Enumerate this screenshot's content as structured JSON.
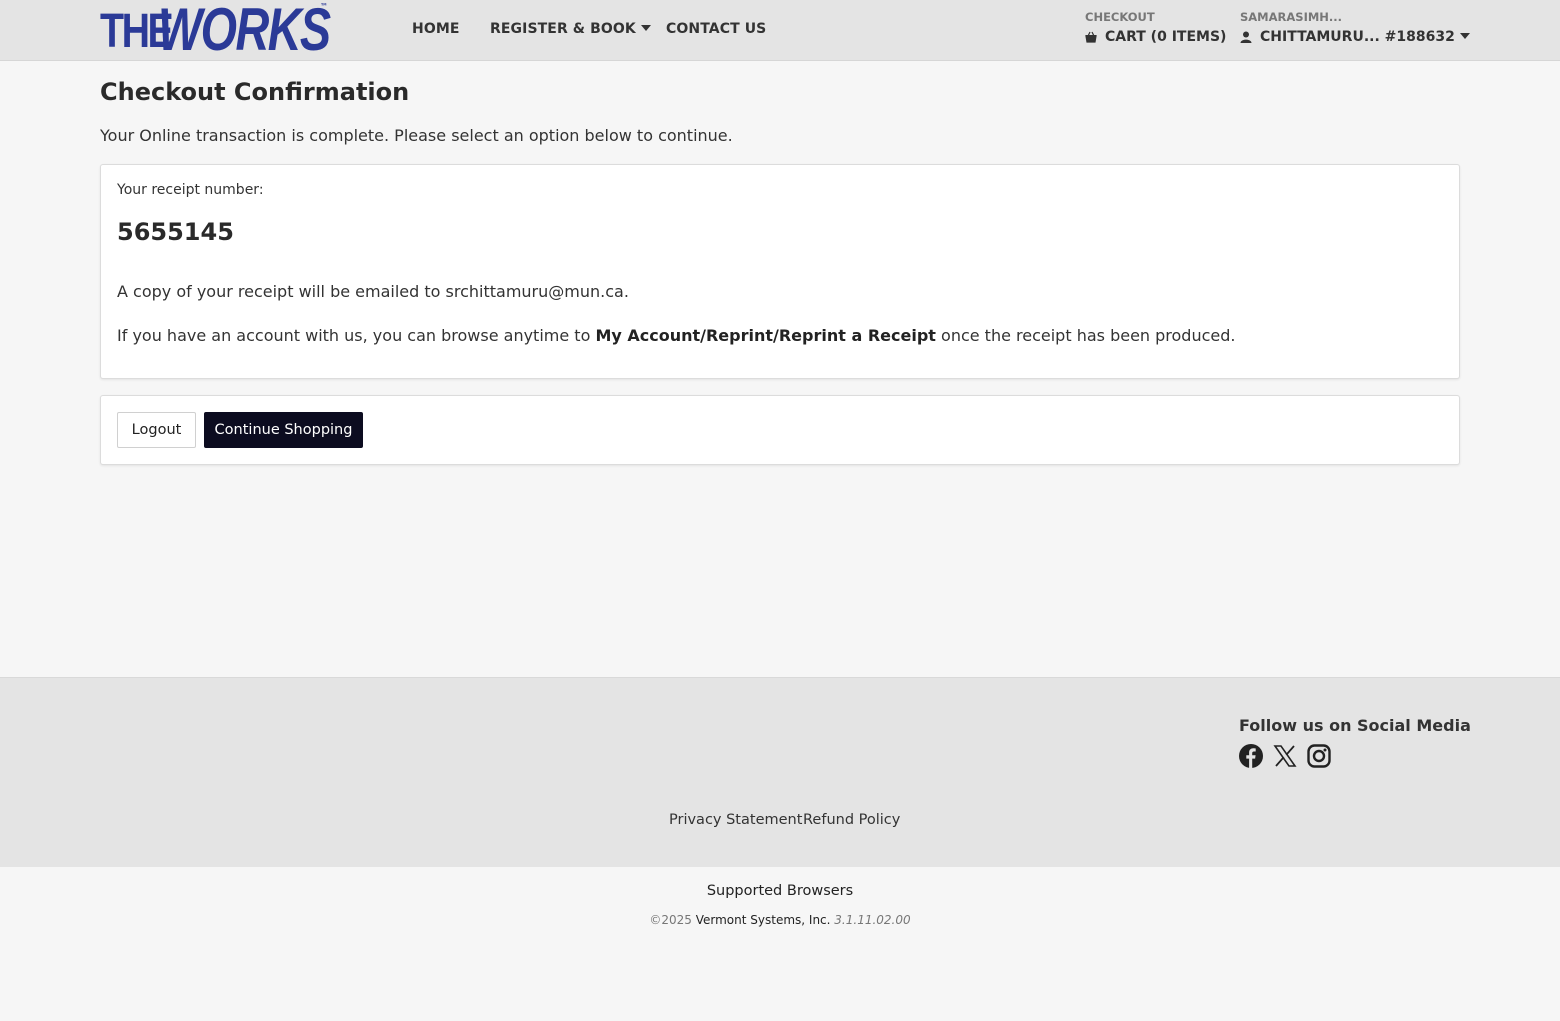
{
  "header": {
    "logo": {
      "the": "THE",
      "works": "WORKS",
      "tm": "™"
    },
    "nav": [
      {
        "label": "HOME"
      },
      {
        "label": "REGISTER & BOOK"
      },
      {
        "label": "CONTACT US"
      }
    ],
    "checkout_label": "CHECKOUT",
    "cart_label": "CART (0 ITEMS)",
    "user_label": "SAMARASIMH...",
    "user_name": "CHITTAMURU... #188632"
  },
  "main": {
    "title": "Checkout Confirmation",
    "lead": "Your Online transaction is complete. Please select an option below to continue.",
    "receipt_label": "Your receipt number:",
    "receipt_number": "5655145",
    "email_line": "A copy of your receipt will be emailed to srchittamuru@mun.ca.",
    "account_prefix": "If you have an account with us, you can browse anytime to ",
    "account_path": "My Account/Reprint/Reprint a Receipt",
    "account_suffix": " once the receipt has been produced.",
    "buttons": {
      "logout": "Logout",
      "continue": "Continue Shopping"
    }
  },
  "footer": {
    "follow": "Follow us on Social Media",
    "social_icons": [
      "facebook-icon",
      "x-icon",
      "instagram-icon"
    ],
    "links": [
      "Privacy Statement",
      "Refund Policy"
    ],
    "supported": "Supported Browsers",
    "copyright": "©2025",
    "company": "Vermont Systems, Inc.",
    "version": "3.1.11.02.00"
  },
  "colors": {
    "brand": "#2b3a97",
    "primary_button": "#0c0c20",
    "header_bg": "#e4e4e4",
    "page_bg": "#f6f6f6"
  }
}
